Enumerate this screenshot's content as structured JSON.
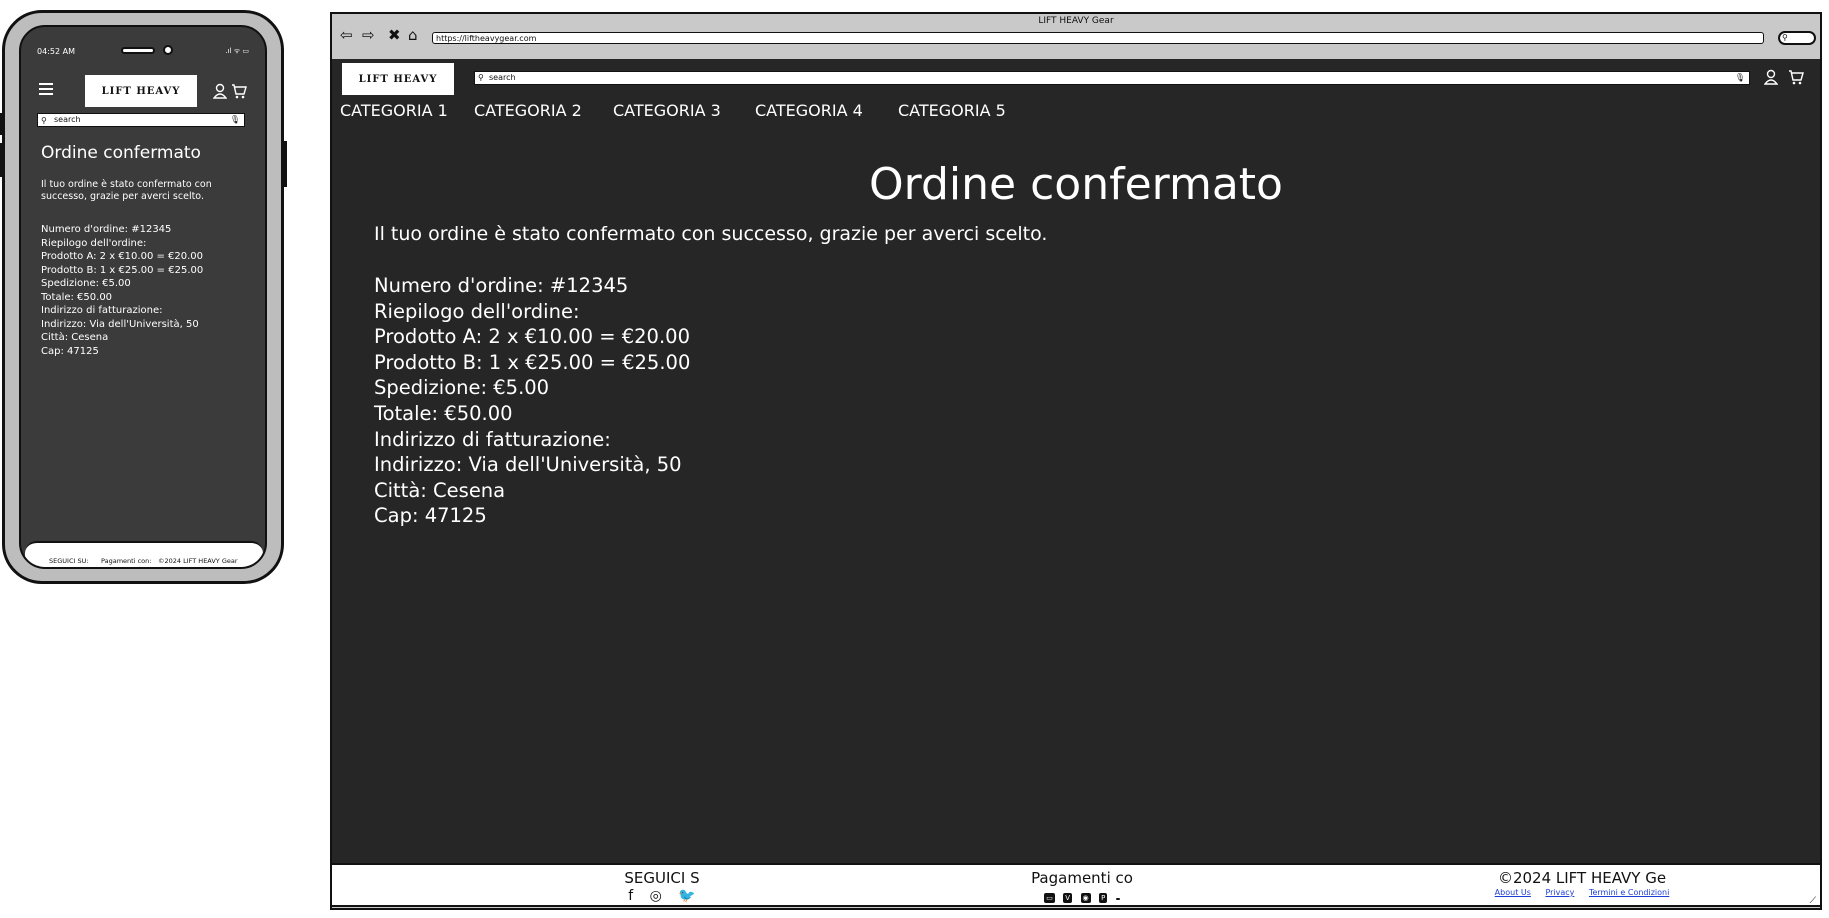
{
  "mobile": {
    "status_time": "04:52 AM",
    "status_icons": ".ıl ᯤ ▭",
    "logo_text": "LIFT HEAVY",
    "search_placeholder": "search",
    "title": "Ordine confermato",
    "message": "Il tuo ordine è stato confermato con successo, grazie per averci scelto.",
    "lines": [
      "Numero d'ordine: #12345",
      "Riepilogo dell'ordine:",
      "Prodotto A: 2 x €10.00 = €20.00",
      "Prodotto B: 1 x €25.00 = €25.00",
      "Spedizione: €5.00",
      "Totale: €50.00",
      "Indirizzo di fatturazione:",
      "Indirizzo: Via dell'Università, 50",
      "Città: Cesena",
      "Cap: 47125"
    ],
    "footer": {
      "follow": "SEGUICI SU:",
      "payments": "Pagamenti con:",
      "copyright": "©2024 LIFT HEAVY Gear"
    }
  },
  "browser": {
    "window_title": "LIFT HEAVY Gear",
    "url": "https://liftheavygear.com",
    "logo_text": "LIFT HEAVY",
    "search_placeholder": "search",
    "categories": [
      "CATEGORIA 1",
      "CATEGORIA 2",
      "CATEGORIA 3",
      "CATEGORIA 4",
      "CATEGORIA 5"
    ],
    "title": "Ordine confermato",
    "message": "Il tuo ordine è stato confermato con successo, grazie per averci scelto.",
    "lines": [
      "Numero d'ordine: #12345",
      "Riepilogo dell'ordine:",
      "Prodotto A: 2 x €10.00 = €20.00",
      "Prodotto B: 1 x €25.00 = €25.00",
      "Spedizione: €5.00",
      "Totale: €50.00",
      "Indirizzo di fatturazione:",
      "Indirizzo: Via dell'Università, 50",
      "Città: Cesena",
      "Cap: 47125"
    ],
    "footer": {
      "follow": "SEGUICI S",
      "social_icons": [
        "facebook-icon",
        "instagram-icon",
        "twitter-icon"
      ],
      "payments": "Pagamenti co",
      "payment_icons": [
        "card-icon",
        "visa-icon",
        "mastercard-icon",
        "paypal-icon",
        "apple-pay-icon"
      ],
      "copyright": "©2024 LIFT HEAVY Ge",
      "links": [
        "About Us",
        "Privacy",
        "Termini e Condizioni"
      ]
    }
  },
  "colors": {
    "page_bg": "#262626",
    "mobile_bg": "#3b3b3b",
    "text": "#ffffff",
    "frame": "#c9c9c9",
    "link": "#1a3fd6"
  }
}
